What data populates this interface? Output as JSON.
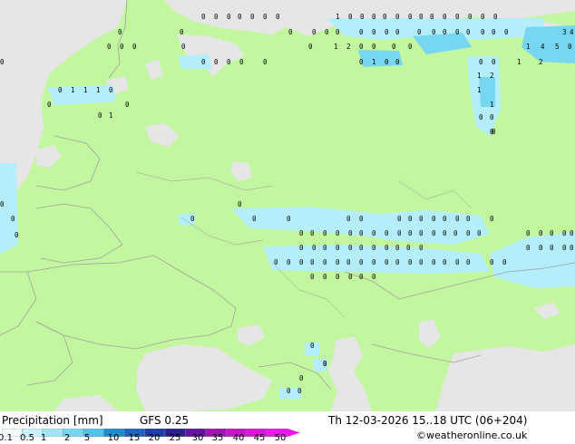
{
  "colors": {
    "land": "#c2f7a0",
    "sea_ice_grey": "#e6e6e6",
    "precip_light": "#b4eefa",
    "precip_medium": "#78d7f0",
    "border": "#a0a0a0",
    "coast": "#9a9a9a"
  },
  "footer": {
    "title": "Precipitation [mm]",
    "model": "GFS 0.25",
    "valid_time": "Th 12-03-2026 15..18 UTC (06+204)",
    "credit": "©weatheronline.co.uk"
  },
  "legend": {
    "labels": [
      "0.1",
      "0.5",
      "1",
      "2",
      "5",
      "10",
      "15",
      "20",
      "25",
      "30",
      "35",
      "40",
      "45",
      "50"
    ],
    "colors": [
      "#f0fcff",
      "#c8f2fc",
      "#a0e6f8",
      "#78d7f0",
      "#50c4e8",
      "#1e8cd2",
      "#1e64be",
      "#1e3caa",
      "#28208c",
      "#6414a0",
      "#a014b4",
      "#c814c8",
      "#dc14dc",
      "#f014f0"
    ]
  },
  "values": {
    "row_a": [
      "0",
      "0",
      "0",
      "0",
      "0",
      "0",
      "0",
      "1",
      "0",
      "0",
      "0",
      "0",
      "0",
      "0",
      "0",
      "0",
      "0",
      "0",
      "0",
      "0",
      "0"
    ],
    "row_b": [
      "0",
      "0",
      "0",
      "0",
      "0",
      "0",
      "0",
      "0",
      "0",
      "0",
      "0",
      "0",
      "0",
      "0",
      "0",
      "0",
      "0",
      "0",
      "3",
      "4"
    ],
    "row_c": [
      "0",
      "0",
      "0",
      "0",
      "0",
      "1",
      "2",
      "0",
      "0",
      "0",
      "0",
      "1",
      "4",
      "5",
      "0"
    ],
    "row_d": [
      "0",
      "0",
      "0",
      "0",
      "0",
      "0",
      "0",
      "1",
      "0",
      "0",
      "0",
      "0",
      "1",
      "2"
    ],
    "row_e": [
      "0",
      "1",
      "1",
      "1",
      "0",
      "0",
      "0",
      "1",
      "0"
    ],
    "row_f": [
      "1",
      "2",
      "1",
      "1",
      "0",
      "0",
      "0",
      "0"
    ],
    "row_g": [
      "0",
      "0",
      "0",
      "0",
      "0",
      "0",
      "0",
      "0",
      "0",
      "0",
      "0",
      "0",
      "0",
      "0",
      "0",
      "0",
      "0"
    ],
    "row_h": [
      "0",
      "0",
      "0",
      "0",
      "0",
      "0",
      "0",
      "0",
      "0",
      "0",
      "0",
      "0",
      "0",
      "0",
      "0",
      "0",
      "0",
      "0",
      "0",
      "0",
      "0",
      "0",
      "0",
      "0",
      "0",
      "0",
      "0",
      "0",
      "0",
      "0",
      "0",
      "0"
    ],
    "row_i": [
      "0",
      "0",
      "0",
      "0",
      "0",
      "0",
      "0",
      "0",
      "0",
      "0",
      "0",
      "0",
      "0",
      "0",
      "0",
      "0",
      "0",
      "0",
      "0",
      "0",
      "0",
      "0",
      "0",
      "0",
      "0",
      "0",
      "0",
      "0",
      "0",
      "0"
    ],
    "row_j": [
      "0",
      "0",
      "0",
      "0",
      "0",
      "0"
    ]
  }
}
